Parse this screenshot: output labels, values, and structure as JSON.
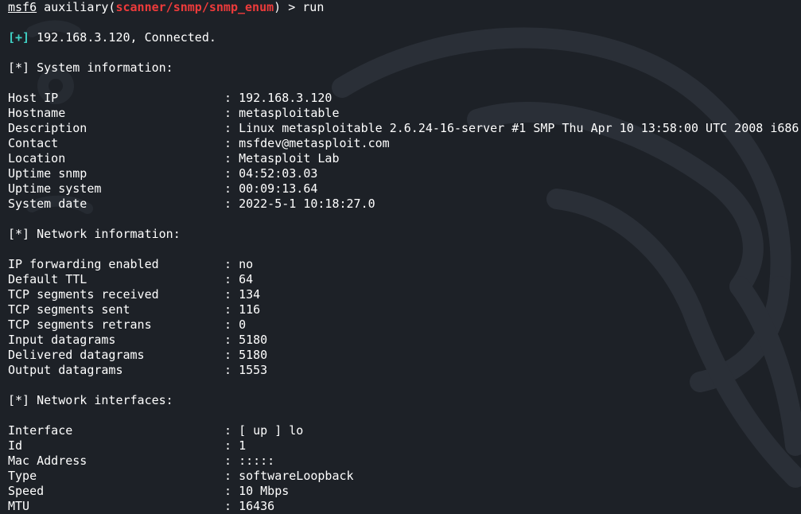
{
  "prompt": {
    "user": "msf6",
    "prefix": " auxiliary(",
    "module": "scanner/snmp/snmp_enum",
    "suffix": ") > ",
    "command": "run"
  },
  "connected": {
    "tag": "[+]",
    "text": " 192.168.3.120, Connected."
  },
  "sections": [
    {
      "heading": "[*] System information:",
      "rows": [
        {
          "key": "Host IP",
          "value": "192.168.3.120"
        },
        {
          "key": "Hostname",
          "value": "metasploitable"
        },
        {
          "key": "Description",
          "value": "Linux metasploitable 2.6.24-16-server #1 SMP Thu Apr 10 13:58:00 UTC 2008 i686"
        },
        {
          "key": "Contact",
          "value": "msfdev@metasploit.com"
        },
        {
          "key": "Location",
          "value": "Metasploit Lab"
        },
        {
          "key": "Uptime snmp",
          "value": "04:52:03.03"
        },
        {
          "key": "Uptime system",
          "value": "00:09:13.64"
        },
        {
          "key": "System date",
          "value": "2022-5-1 10:18:27.0"
        }
      ]
    },
    {
      "heading": "[*] Network information:",
      "rows": [
        {
          "key": "IP forwarding enabled",
          "value": "no"
        },
        {
          "key": "Default TTL",
          "value": "64"
        },
        {
          "key": "TCP segments received",
          "value": "134"
        },
        {
          "key": "TCP segments sent",
          "value": "116"
        },
        {
          "key": "TCP segments retrans",
          "value": "0"
        },
        {
          "key": "Input datagrams",
          "value": "5180"
        },
        {
          "key": "Delivered datagrams",
          "value": "5180"
        },
        {
          "key": "Output datagrams",
          "value": "1553"
        }
      ]
    },
    {
      "heading": "[*] Network interfaces:",
      "rows": [
        {
          "key": "Interface",
          "value": "[ up ] lo"
        },
        {
          "key": "Id",
          "value": "1"
        },
        {
          "key": "Mac Address",
          "value": ":::::"
        },
        {
          "key": "Type",
          "value": "softwareLoopback"
        },
        {
          "key": "Speed",
          "value": "10 Mbps"
        },
        {
          "key": "MTU",
          "value": "16436"
        }
      ]
    }
  ],
  "separator": ": ",
  "colors": {
    "background": "#1d2127",
    "text": "#ffffff",
    "module": "#ee3b3b",
    "status_plus": "#3fd0c4"
  },
  "icons": {
    "background": "kali-dragon-icon"
  }
}
